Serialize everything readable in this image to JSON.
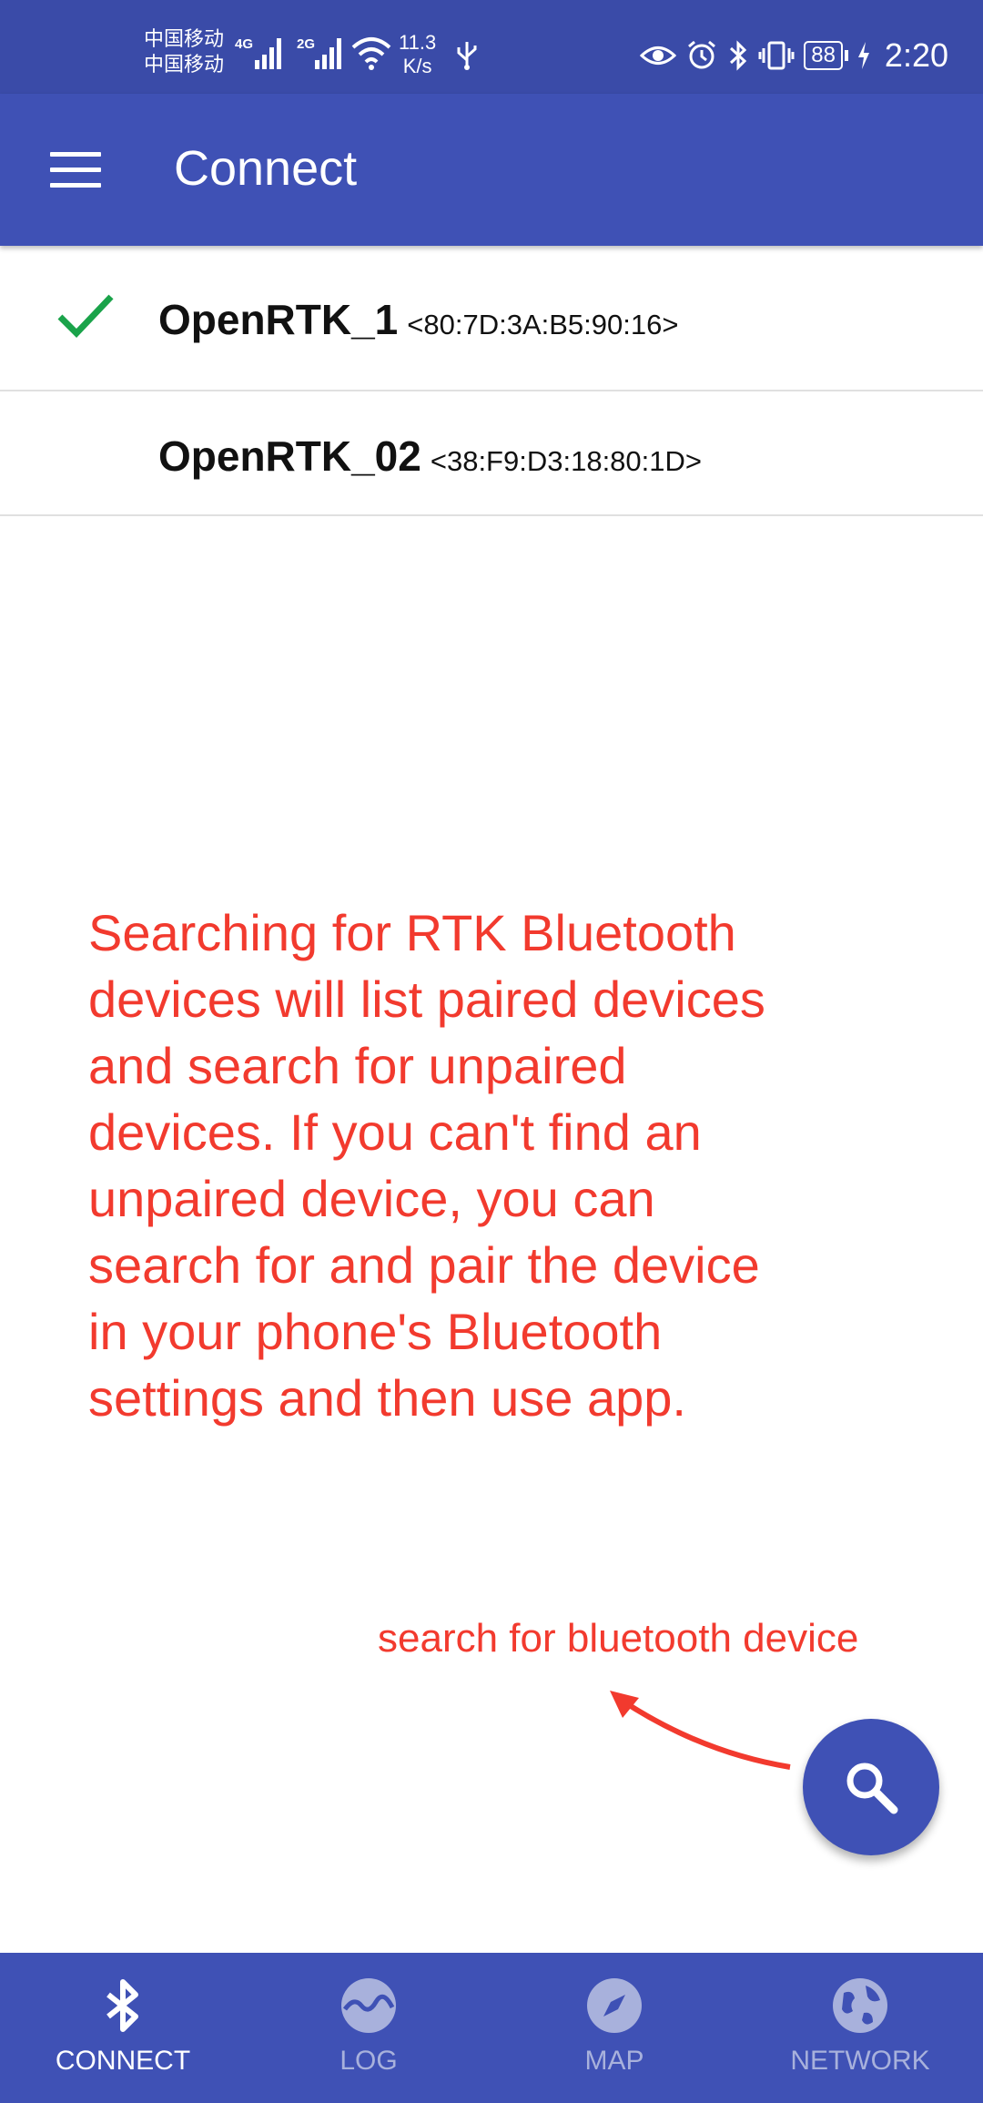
{
  "status_bar": {
    "carrier_1": "中国移动",
    "carrier_2": "中国移动",
    "network_1": "4G",
    "network_2": "2G",
    "speed_value": "11.3",
    "speed_unit": "K/s",
    "battery": "88",
    "time": "2:20",
    "icons": [
      "eye-icon",
      "alarm-icon",
      "bluetooth-icon",
      "vibrate-icon",
      "usb-icon",
      "wifi-icon",
      "signal-icon",
      "charging-icon"
    ]
  },
  "app_bar": {
    "title": "Connect",
    "menu_icon": "hamburger-menu-icon"
  },
  "devices": [
    {
      "name": "OpenRTK_1",
      "address": "<80:7D:3A:B5:90:16>",
      "connected": true
    },
    {
      "name": "OpenRTK_02",
      "address": "<38:F9:D3:18:80:1D>",
      "connected": false
    }
  ],
  "annotation": {
    "lines": [
      "Searching for RTK Bluetooth",
      "devices will list paired devices",
      "and search for unpaired",
      "devices. If you can't find an",
      "unpaired device, you can",
      "search for and pair the device",
      "in your phone's Bluetooth",
      "settings and then use app."
    ],
    "hint": "search for bluetooth device"
  },
  "fab": {
    "icon": "search-icon"
  },
  "bottom_nav": {
    "items": [
      {
        "label": "CONNECT",
        "icon": "bluetooth-icon",
        "active": true
      },
      {
        "label": "LOG",
        "icon": "log-chart-icon",
        "active": false
      },
      {
        "label": "MAP",
        "icon": "compass-icon",
        "active": false
      },
      {
        "label": "NETWORK",
        "icon": "globe-icon",
        "active": false
      }
    ]
  },
  "colors": {
    "primary": "#3f51b5",
    "status_bar": "#3a4ba8",
    "annotation": "#f23a2e",
    "check": "#1aa34a",
    "nav_inactive": "#a8b1dc"
  }
}
